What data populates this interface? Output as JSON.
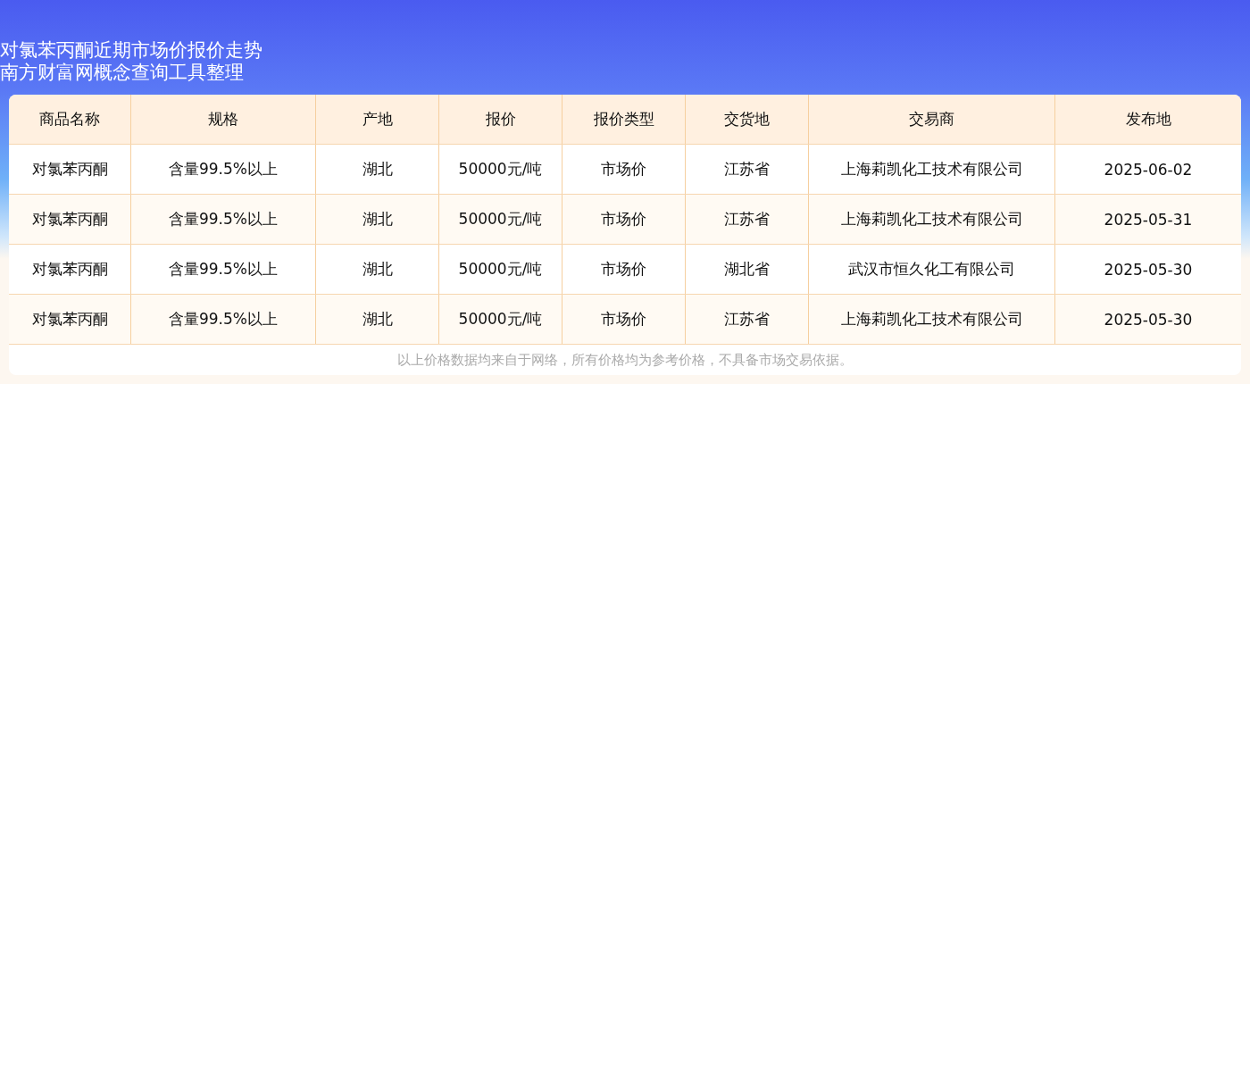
{
  "title": [
    "对氯苯丙酮近期市场价报价走势",
    "南方财富网概念查询工具整理"
  ],
  "table": {
    "columns": [
      "商品名称",
      "规格",
      "产地",
      "报价",
      "报价类型",
      "交货地",
      "交易商",
      "发布地"
    ],
    "rows": [
      [
        "对氯苯丙酮",
        "含量99.5%以上",
        "湖北",
        "50000元/吨",
        "市场价",
        "江苏省",
        "上海莉凯化工技术有限公司",
        "2025-06-02"
      ],
      [
        "对氯苯丙酮",
        "含量99.5%以上",
        "湖北",
        "50000元/吨",
        "市场价",
        "江苏省",
        "上海莉凯化工技术有限公司",
        "2025-05-31"
      ],
      [
        "对氯苯丙酮",
        "含量99.5%以上",
        "湖北",
        "50000元/吨",
        "市场价",
        "湖北省",
        "武汉市恒久化工有限公司",
        "2025-05-30"
      ],
      [
        "对氯苯丙酮",
        "含量99.5%以上",
        "湖北",
        "50000元/吨",
        "市场价",
        "江苏省",
        "上海莉凯化工技术有限公司",
        "2025-05-30"
      ]
    ]
  },
  "note": "以上价格数据均来自于网络，所有价格均为参考价格，不具备市场交易依据。"
}
